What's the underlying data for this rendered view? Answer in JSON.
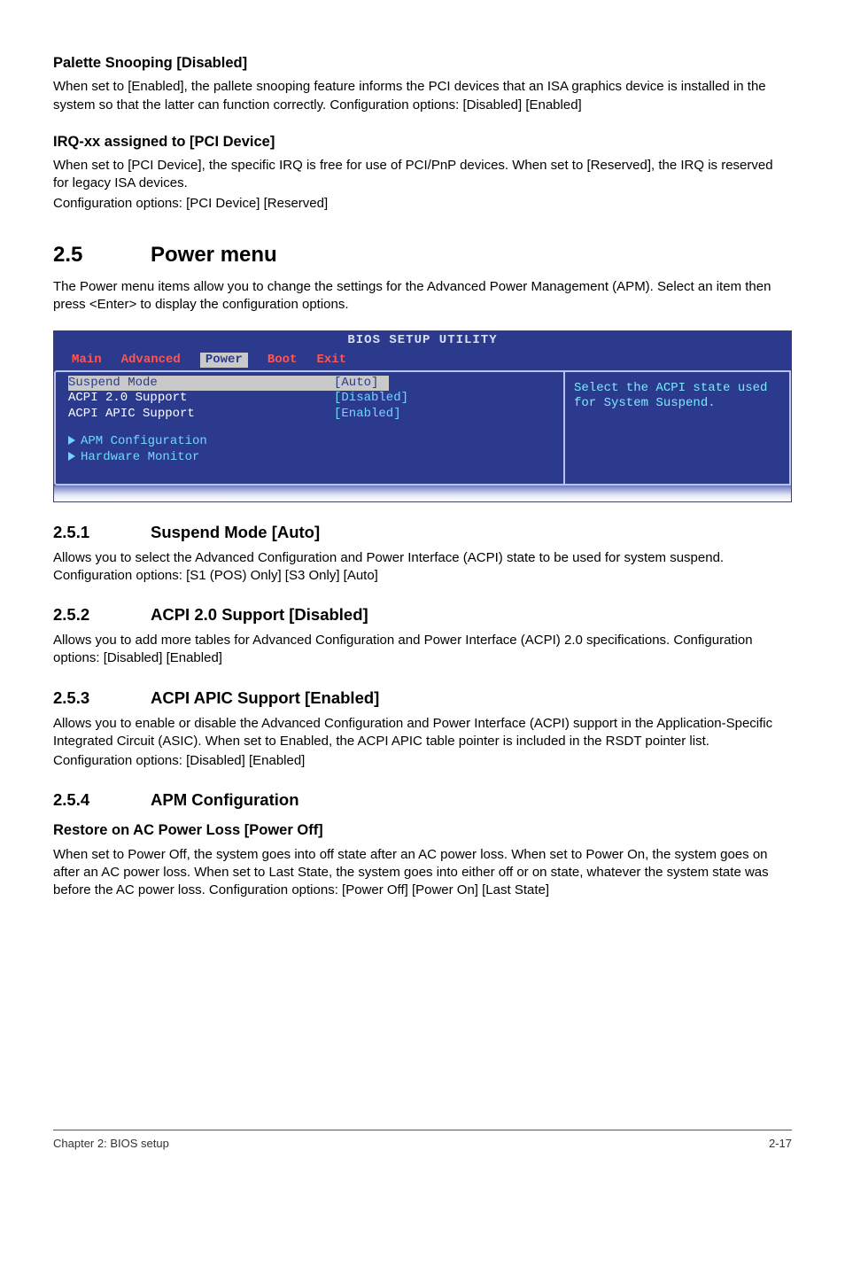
{
  "sections": {
    "palette": {
      "heading": "Palette Snooping [Disabled]",
      "body": "When set to [Enabled], the pallete snooping feature informs the PCI devices that an ISA graphics device is installed in the system so that the latter can function correctly. Configuration options: [Disabled] [Enabled]"
    },
    "irq": {
      "heading": "IRQ-xx assigned to [PCI Device]",
      "body1": "When set to [PCI Device], the specific IRQ is free for use of PCI/PnP devices. When set to [Reserved], the IRQ is reserved for legacy ISA devices.",
      "body2": "Configuration options: [PCI Device] [Reserved]"
    }
  },
  "power_menu": {
    "num": "2.5",
    "title": "Power menu",
    "intro": "The Power menu items allow you to change the settings for the Advanced Power Management (APM). Select an item then press <Enter> to display the configuration options."
  },
  "bios": {
    "title_banner": "BIOS SETUP UTILITY",
    "tabs": [
      "Main",
      "Advanced",
      "Power",
      "Boot",
      "Exit"
    ],
    "active_tab": "Power",
    "rows": [
      {
        "label": "Suspend Mode",
        "value": "[Auto]",
        "selected": true
      },
      {
        "label": "ACPI 2.0 Support",
        "value": "[Disabled]",
        "selected": false
      },
      {
        "label": "ACPI APIC Support",
        "value": "[Enabled]",
        "selected": false
      }
    ],
    "subs": [
      "APM Configuration",
      "Hardware Monitor"
    ],
    "help": "Select the ACPI state used for System Suspend."
  },
  "subs": {
    "s251": {
      "num": "2.5.1",
      "title": "Suspend Mode [Auto]",
      "body": "Allows you to select the Advanced Configuration and Power Interface (ACPI) state to be used for system suspend. Configuration options: [S1 (POS) Only] [S3 Only] [Auto]"
    },
    "s252": {
      "num": "2.5.2",
      "title": "ACPI 2.0 Support [Disabled]",
      "body": "Allows you to add more tables for Advanced Configuration and Power Interface (ACPI) 2.0 specifications. Configuration options: [Disabled] [Enabled]"
    },
    "s253": {
      "num": "2.5.3",
      "title": "ACPI APIC Support [Enabled]",
      "body1": "Allows you to enable or disable the Advanced Configuration and Power Interface (ACPI) support in the Application-Specific Integrated Circuit (ASIC). When set to Enabled, the ACPI APIC table pointer is included in the RSDT pointer list.",
      "body2": "Configuration options: [Disabled] [Enabled]"
    },
    "s254": {
      "num": "2.5.4",
      "title": "APM Configuration",
      "restore_heading": "Restore on AC Power Loss [Power Off]",
      "restore_body": "When set to Power Off, the system goes into off state after an AC power loss. When set to Power On, the system goes on after an AC power loss. When set to Last State, the system goes into either off or on state, whatever the system state was before the AC power loss. Configuration options: [Power Off] [Power On] [Last State]"
    }
  },
  "footer": {
    "left": "Chapter 2: BIOS setup",
    "right": "2-17"
  }
}
